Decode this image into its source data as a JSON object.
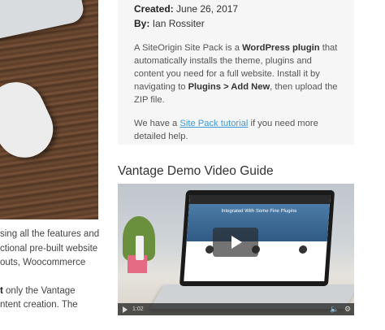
{
  "left": {
    "paragraph1": [
      "sing all the features and",
      "ctional pre-built website",
      "outs, Woocommerce"
    ],
    "paragraph2_bold": "t",
    "paragraph2_line1_rest": " only the Vantage",
    "paragraph2_line2": "ntent creation. The"
  },
  "info_box": {
    "created_label": "Created:",
    "created_value": "June 26, 2017",
    "by_label": "By:",
    "by_value": "Ian Rossiter",
    "p1": {
      "t1": "A SiteOrigin Site Pack is a ",
      "b1": "WordPress plugin",
      "t2": " that automatically installs the theme, plugins and content you need for a full website. Install it by navigating to ",
      "b2": "Plugins > Add New",
      "t3": ", then upload the ZIP file."
    },
    "p2": {
      "t1": "We have a ",
      "link": "Site Pack tutorial",
      "t2": " if you need more detailed help."
    }
  },
  "video": {
    "heading": "Vantage Demo Video Guide",
    "screen_headline": "Integrated With Some Fine Plugins",
    "time": "1:02",
    "volume_icon": "volume-icon",
    "settings_icon": "gear-icon",
    "play_icon": "play-icon"
  }
}
